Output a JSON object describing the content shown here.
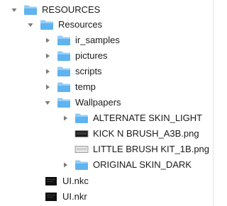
{
  "tree": {
    "root": {
      "label": "RESOURCES",
      "expanded": true,
      "icon": "folder-icon"
    },
    "resources": {
      "label": "Resources",
      "expanded": true,
      "icon": "folder-icon"
    },
    "ir_samples": {
      "label": "ir_samples",
      "expanded": false,
      "icon": "folder-icon"
    },
    "pictures": {
      "label": "pictures",
      "expanded": false,
      "icon": "folder-icon"
    },
    "scripts": {
      "label": "scripts",
      "expanded": false,
      "icon": "folder-icon"
    },
    "temp": {
      "label": "temp",
      "expanded": false,
      "icon": "folder-icon"
    },
    "wallpapers": {
      "label": "Wallpapers",
      "expanded": true,
      "icon": "folder-icon"
    },
    "alternate_skin_light": {
      "label": "ALTERNATE SKIN_LIGHT",
      "expanded": false,
      "icon": "folder-icon"
    },
    "kick_n_brush": {
      "label": "KICK N BRUSH_A3B.png",
      "icon": "png-thumbnail-dark-icon"
    },
    "little_brush_kit": {
      "label": "LITTLE BRUSH KIT_1B.png",
      "icon": "png-thumbnail-light-icon"
    },
    "original_skin_dark": {
      "label": "ORIGINAL SKIN_DARK",
      "expanded": false,
      "icon": "folder-icon"
    },
    "ui_nkc": {
      "label": "UI.nkc",
      "icon": "document-dark-icon"
    },
    "ui_nkr": {
      "label": "UI.nkr",
      "icon": "document-dark-icon"
    }
  },
  "colors": {
    "folder_body": "#5fb3ef",
    "folder_tab": "#8fcbf5",
    "disclosure": "#7a7a7a",
    "text": "#1a1a1a"
  }
}
